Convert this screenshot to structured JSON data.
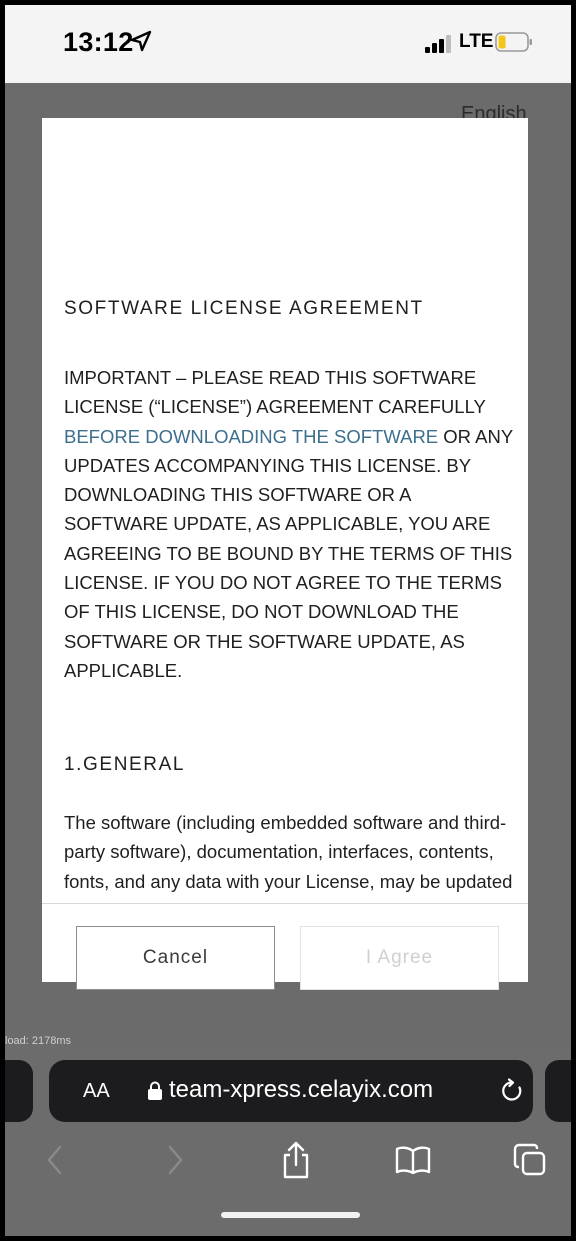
{
  "status_bar": {
    "time": "13:12",
    "network": "LTE"
  },
  "page": {
    "language": "English",
    "load_time": "load: 2178ms"
  },
  "modal": {
    "title": "SOFTWARE LICENSE AGREEMENT",
    "important_part1": "IMPORTANT – PLEASE READ THIS SOFTWARE LICENSE (“LICENSE”) AGREEMENT CAREFULLY ",
    "important_link": "BEFORE DOWNLOADING THE SOFTWARE",
    "important_part2": " OR ANY UPDATES ACCOMPANYING THIS LICENSE. BY DOWNLOADING THIS SOFTWARE OR A SOFTWARE UPDATE, AS APPLICABLE, YOU ARE AGREEING TO BE BOUND BY THE TERMS OF THIS LICENSE. IF YOU DO NOT AGREE TO THE TERMS OF THIS LICENSE, DO NOT DOWNLOAD THE SOFTWARE OR THE SOFTWARE UPDATE, AS APPLICABLE.",
    "section_heading": "1.GENERAL",
    "section_body": "The software (including embedded software and third-party software), documentation, interfaces, contents, fonts, and any data with your License, may be updated or replaced by feature enhancements, software updates or systems restore software provided by Celayix Inc. (Celayix), a company incorporated under the",
    "cancel_label": "Cancel",
    "agree_label": "I Agree"
  },
  "browser": {
    "aa_label": "AA",
    "url": "team-xpress.celayix.com"
  },
  "colors": {
    "link": "#3d6f8e",
    "overlay": "#6b6b6b",
    "url_bar": "#1c1c1e"
  }
}
